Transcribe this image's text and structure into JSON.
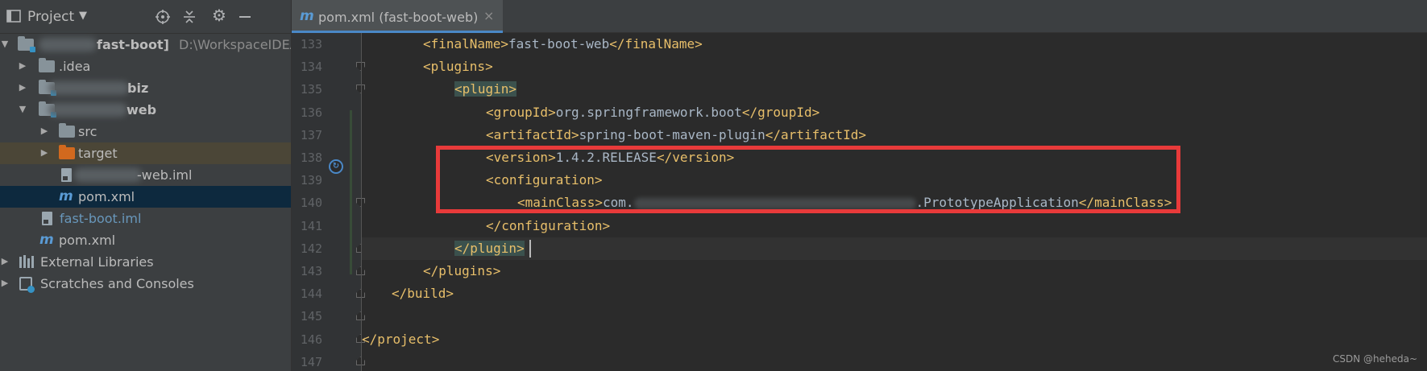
{
  "project_panel": {
    "title": "Project",
    "tree": [
      {
        "label": "fast-boot]",
        "path": "D:\\WorkspaceIDEA",
        "type": "module-root",
        "expanded": true
      },
      {
        "label": ".idea",
        "type": "folder"
      },
      {
        "label": "biz",
        "type": "module",
        "redacted_prefix": true
      },
      {
        "label": "web",
        "type": "module",
        "redacted_prefix": true,
        "expanded": true
      },
      {
        "label": "src",
        "type": "folder"
      },
      {
        "label": "target",
        "type": "folder-excluded"
      },
      {
        "label": "-web.iml",
        "type": "iml-file",
        "redacted_prefix": true
      },
      {
        "label": "pom.xml",
        "type": "maven-file",
        "selected": true
      },
      {
        "label": "fast-boot.iml",
        "type": "iml-file"
      },
      {
        "label": "pom.xml",
        "type": "maven-file"
      },
      {
        "label": "External Libraries",
        "type": "libraries"
      },
      {
        "label": "Scratches and Consoles",
        "type": "scratches"
      }
    ]
  },
  "editor": {
    "tab": {
      "title": "pom.xml (fast-boot-web)",
      "close": "×"
    },
    "line_numbers": [
      "133",
      "134",
      "135",
      "136",
      "137",
      "138",
      "139",
      "140",
      "141",
      "142",
      "143",
      "144",
      "145",
      "146",
      "147"
    ],
    "lines": {
      "l133": {
        "open": "<finalName>",
        "text": "fast-boot-web",
        "close": "</finalName>"
      },
      "l134": {
        "open": "<plugins>"
      },
      "l135": {
        "open": "<plugin>"
      },
      "l136": {
        "open": "<groupId>",
        "text": "org.springframework.boot",
        "close": "</groupId>"
      },
      "l137": {
        "open": "<artifactId>",
        "text": "spring-boot-maven-plugin",
        "close": "</artifactId>"
      },
      "l138": {
        "open": "<version>",
        "text": "1.4.2.RELEASE",
        "close": "</version>"
      },
      "l139": {
        "open": "<configuration>"
      },
      "l140": {
        "open": "<mainClass>",
        "text_start": "com.",
        "text_end": ".PrototypeApplication",
        "close": "</mainClass>"
      },
      "l141": {
        "close": "</configuration>"
      },
      "l142": {
        "close": "</plugin>"
      },
      "l143": {
        "close": "</plugins>"
      },
      "l144": {
        "close": "</build>"
      },
      "l146": {
        "close": "</project>"
      }
    }
  },
  "watermark": "CSDN @heheda~",
  "colors": {
    "tag": "#e8bf6a",
    "text": "#a9b7c6",
    "line_number": "#606366",
    "highlight_box": "#e83a3a",
    "selection": "#0d293e",
    "accent": "#4a88c7"
  },
  "icons": [
    "project-view-icon",
    "locate-icon",
    "collapse-icon",
    "gear-icon",
    "minimize-icon",
    "maven-icon",
    "folder-icon",
    "module-icon",
    "iml-file-icon",
    "libraries-icon",
    "scratches-icon",
    "run-gutter-icon"
  ]
}
